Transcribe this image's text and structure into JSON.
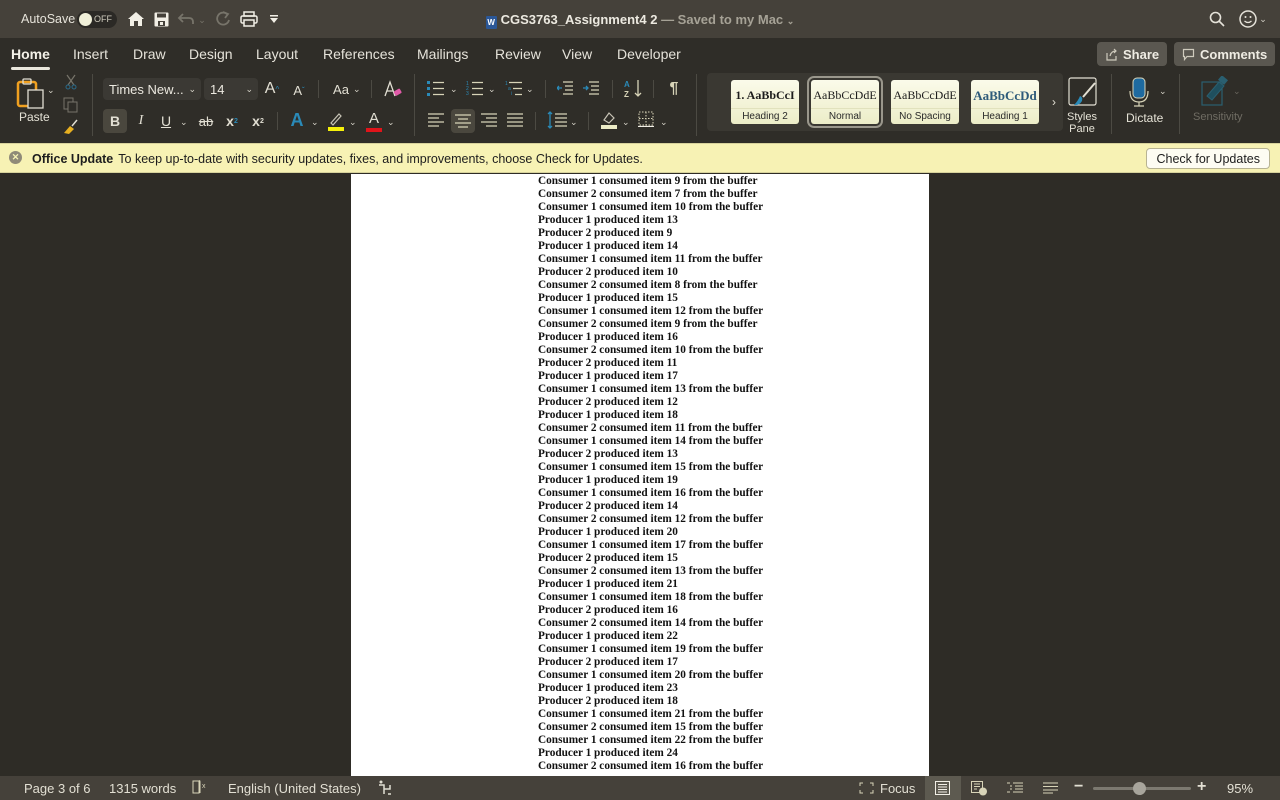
{
  "titlebar": {
    "autosave_label": "AutoSave",
    "autosave_state": "OFF",
    "document_name": "CGS3763_Assignment4 2",
    "save_status": "— Saved to my Mac",
    "icons": [
      "home-icon",
      "save-icon",
      "undo-icon",
      "redo-icon",
      "print-icon",
      "customize-toolbar-icon",
      "search-icon",
      "account-smiley-icon"
    ]
  },
  "tabs": [
    {
      "label": "Home",
      "active": true
    },
    {
      "label": "Insert"
    },
    {
      "label": "Draw"
    },
    {
      "label": "Design"
    },
    {
      "label": "Layout"
    },
    {
      "label": "References"
    },
    {
      "label": "Mailings"
    },
    {
      "label": "Review"
    },
    {
      "label": "View"
    },
    {
      "label": "Developer"
    }
  ],
  "header_actions": {
    "share_label": "Share",
    "comments_label": "Comments"
  },
  "ribbon": {
    "paste_label": "Paste",
    "font_name": "Times New...",
    "font_size": "14",
    "change_case_label": "Aa",
    "bold_label": "B",
    "italic_label": "I",
    "underline_label": "U",
    "strikethrough_label": "ab",
    "subscript_label": "x",
    "superscript_label": "x",
    "grow_font_label": "A",
    "shrink_font_label": "A",
    "text_effects_label": "A",
    "font_color_label": "A",
    "highlight_color": "#f5f00a",
    "font_color": "#e0141a",
    "styles": [
      {
        "sample": "1.  AaBbCcI",
        "name": "Heading 2"
      },
      {
        "sample": "AaBbCcDdE",
        "name": "Normal",
        "selected": true
      },
      {
        "sample": "AaBbCcDdE",
        "name": "No Spacing"
      },
      {
        "sample": "AaBbCcDd",
        "name": "Heading 1"
      }
    ],
    "styles_pane_label_1": "Styles",
    "styles_pane_label_2": "Pane",
    "dictate_label": "Dictate",
    "sensitivity_label": "Sensitivity"
  },
  "update_bar": {
    "title": "Office Update",
    "message": "To keep up-to-date with security updates, fixes, and improvements, choose Check for Updates.",
    "button_label": "Check for Updates"
  },
  "document": {
    "lines": [
      "Consumer 1 consumed item 9 from the buffer",
      "Consumer 2 consumed item 7 from the buffer",
      "Consumer 1 consumed item 10 from the buffer",
      "Producer 1 produced item 13",
      "Producer 2 produced item 9",
      "Producer 1 produced item 14",
      "Consumer 1 consumed item 11 from the buffer",
      "Producer 2 produced item 10",
      "Consumer 2 consumed item 8 from the buffer",
      "Producer 1 produced item 15",
      "Consumer 1 consumed item 12 from the buffer",
      "Consumer 2 consumed item 9 from the buffer",
      "Producer 1 produced item 16",
      "Consumer 2 consumed item 10 from the buffer",
      "Producer 2 produced item 11",
      "Producer 1 produced item 17",
      "Consumer 1 consumed item 13 from the buffer",
      "Producer 2 produced item 12",
      "Producer 1 produced item 18",
      "Consumer 2 consumed item 11 from the buffer",
      "Consumer 1 consumed item 14 from the buffer",
      "Producer 2 produced item 13",
      "Consumer 1 consumed item 15 from the buffer",
      "Producer 1 produced item 19",
      "Consumer 1 consumed item 16 from the buffer",
      "Producer 2 produced item 14",
      "Consumer 2 consumed item 12 from the buffer",
      "Producer 1 produced item 20",
      "Consumer 1 consumed item 17 from the buffer",
      "Producer 2 produced item 15",
      "Consumer 2 consumed item 13 from the buffer",
      "Producer 1 produced item 21",
      "Consumer 1 consumed item 18 from the buffer",
      "Producer 2 produced item 16",
      "Consumer 2 consumed item 14 from the buffer",
      "Producer 1 produced item 22",
      "Consumer 1 consumed item 19 from the buffer",
      "Producer 2 produced item 17",
      "Consumer 1 consumed item 20 from the buffer",
      "Producer 1 produced item 23",
      "Producer 2 produced item 18",
      "Consumer 1 consumed item 21 from the buffer",
      "Consumer 2 consumed item 15 from the buffer",
      "Consumer 1 consumed item 22 from the buffer",
      "Producer 1 produced item 24",
      "Consumer 2 consumed item 16 from the buffer"
    ]
  },
  "statusbar": {
    "page_info": "Page 3 of 6",
    "word_count": "1315 words",
    "language": "English (United States)",
    "focus_label": "Focus",
    "zoom_percent": "95%",
    "zoom_slider_fraction": 0.47
  }
}
